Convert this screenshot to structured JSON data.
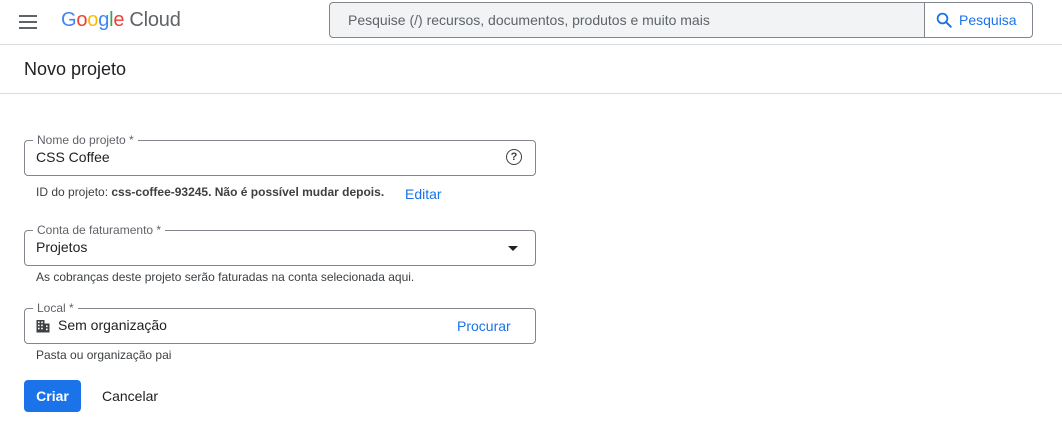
{
  "header": {
    "logo_google_letters": [
      "G",
      "o",
      "o",
      "g",
      "l",
      "e"
    ],
    "logo_colors": [
      "#4285F4",
      "#EA4335",
      "#FBBC05",
      "#4285F4",
      "#34A853",
      "#EA4335"
    ],
    "logo_cloud": "Cloud",
    "search_placeholder": "Pesquise (/) recursos, documentos, produtos e muito mais",
    "search_button_label": "Pesquisa"
  },
  "page": {
    "title": "Novo projeto"
  },
  "form": {
    "project_name": {
      "label": "Nome do projeto *",
      "value": "CSS Coffee"
    },
    "project_id": {
      "prefix": "ID do projeto: ",
      "id_text": "css-coffee-93245. Não é possível mudar depois.",
      "edit_link": "Editar"
    },
    "billing": {
      "label": "Conta de faturamento *",
      "value": "Projetos",
      "help": "As cobranças deste projeto serão faturadas na conta selecionada aqui."
    },
    "location": {
      "label": "Local *",
      "value": "Sem organização",
      "browse_link": "Procurar",
      "help": "Pasta ou organização pai"
    }
  },
  "actions": {
    "create": "Criar",
    "cancel": "Cancelar"
  },
  "colors": {
    "accent": "#1a73e8",
    "border": "#80868b",
    "divider": "#dadce0"
  }
}
